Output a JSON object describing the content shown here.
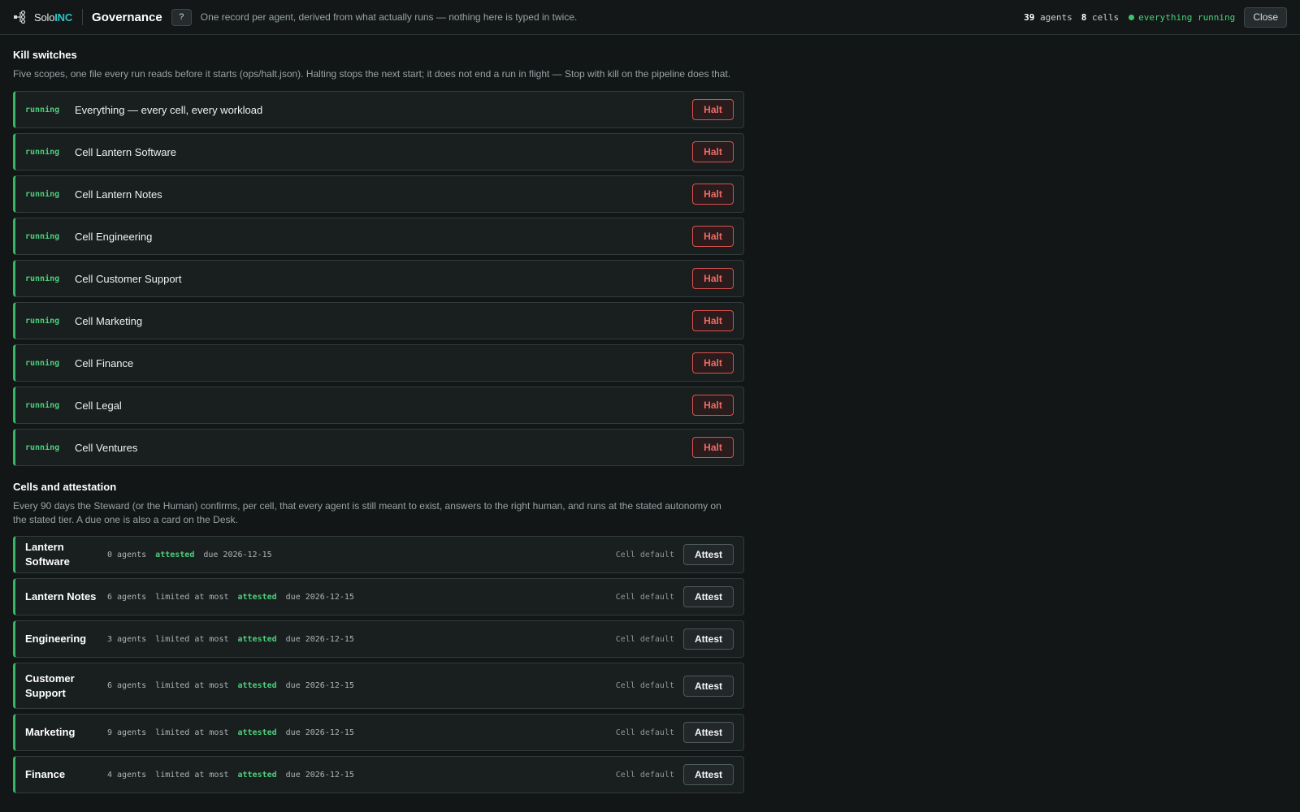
{
  "header": {
    "brand_solo": "Solo",
    "brand_inc": "INC",
    "title": "Governance",
    "help_label": "?",
    "subtitle": "One record per agent, derived from what actually runs — nothing here is typed in twice.",
    "agents_count": "39",
    "agents_label": "agents",
    "cells_count": "8",
    "cells_label": "cells",
    "status_text": "everything running",
    "close_label": "Close"
  },
  "kill_switches": {
    "title": "Kill switches",
    "description": "Five scopes, one file every run reads before it starts (ops/halt.json). Halting stops the next start; it does not end a run in flight — Stop with kill on the pipeline does that.",
    "items": [
      {
        "state": "running",
        "scope": "Everything — every cell, every workload",
        "action": "Halt"
      },
      {
        "state": "running",
        "scope": "Cell Lantern Software",
        "action": "Halt"
      },
      {
        "state": "running",
        "scope": "Cell Lantern Notes",
        "action": "Halt"
      },
      {
        "state": "running",
        "scope": "Cell Engineering",
        "action": "Halt"
      },
      {
        "state": "running",
        "scope": "Cell Customer Support",
        "action": "Halt"
      },
      {
        "state": "running",
        "scope": "Cell Marketing",
        "action": "Halt"
      },
      {
        "state": "running",
        "scope": "Cell Finance",
        "action": "Halt"
      },
      {
        "state": "running",
        "scope": "Cell Legal",
        "action": "Halt"
      },
      {
        "state": "running",
        "scope": "Cell Ventures",
        "action": "Halt"
      }
    ]
  },
  "cells": {
    "title": "Cells and attestation",
    "description": "Every 90 days the Steward (or the Human) confirms, per cell, that every agent is still meant to exist, answers to the right human, and runs at the stated autonomy on the stated tier. A due one is also a card on the Desk.",
    "items": [
      {
        "name": "Lantern Software",
        "agents": "0 agents",
        "limit": "",
        "status": "attested",
        "due": "due 2026-12-15",
        "tier": "Cell default",
        "action": "Attest"
      },
      {
        "name": "Lantern Notes",
        "agents": "6 agents",
        "limit": "limited at most",
        "status": "attested",
        "due": "due 2026-12-15",
        "tier": "Cell default",
        "action": "Attest"
      },
      {
        "name": "Engineering",
        "agents": "3 agents",
        "limit": "limited at most",
        "status": "attested",
        "due": "due 2026-12-15",
        "tier": "Cell default",
        "action": "Attest"
      },
      {
        "name": "Customer Support",
        "agents": "6 agents",
        "limit": "limited at most",
        "status": "attested",
        "due": "due 2026-12-15",
        "tier": "Cell default",
        "action": "Attest"
      },
      {
        "name": "Marketing",
        "agents": "9 agents",
        "limit": "limited at most",
        "status": "attested",
        "due": "due 2026-12-15",
        "tier": "Cell default",
        "action": "Attest"
      },
      {
        "name": "Finance",
        "agents": "4 agents",
        "limit": "limited at most",
        "status": "attested",
        "due": "due 2026-12-15",
        "tier": "Cell default",
        "action": "Attest"
      }
    ]
  },
  "colors": {
    "running": "#4bd07a",
    "halt": "#f06a65",
    "brand_accent": "#2ec4c4"
  }
}
